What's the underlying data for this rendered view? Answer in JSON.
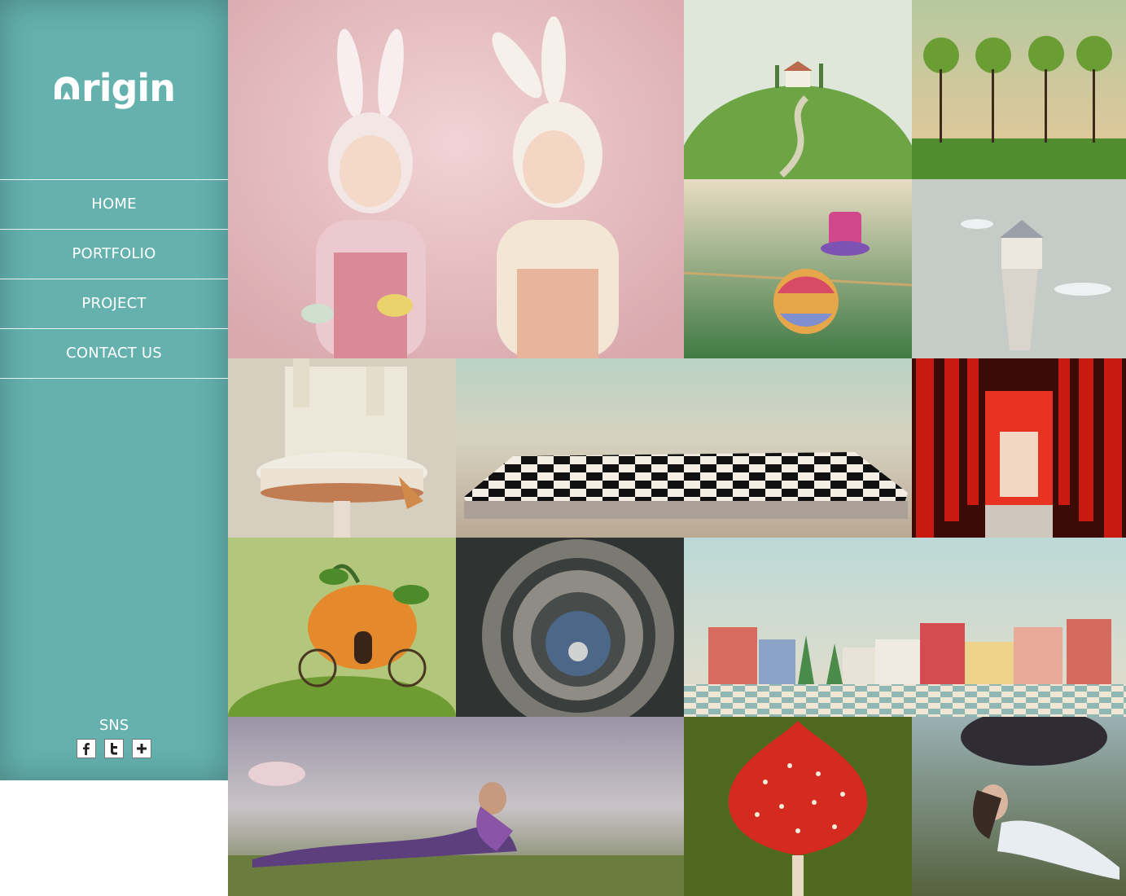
{
  "brand": {
    "logo_text": "rigin",
    "logo_alt": "Origin"
  },
  "nav": [
    {
      "label": "HOME"
    },
    {
      "label": "PORTFOLIO"
    },
    {
      "label": "PROJECT"
    },
    {
      "label": "CONTACT US"
    }
  ],
  "sns": {
    "label": "SNS",
    "icons": [
      "facebook-icon",
      "twitter-icon",
      "plus-icon"
    ]
  },
  "colors": {
    "sidebar": "#64b1ae",
    "text": "#ffffff"
  },
  "gallery": [
    {
      "name": "bunny-girls"
    },
    {
      "name": "green-hill-house"
    },
    {
      "name": "round-trees"
    },
    {
      "name": "tightrope-ball-hat"
    },
    {
      "name": "tower-castle"
    },
    {
      "name": "castle-cake"
    },
    {
      "name": "chessboard-landscape"
    },
    {
      "name": "red-torii-gates"
    },
    {
      "name": "pumpkin-carriage"
    },
    {
      "name": "spiral-staircase"
    },
    {
      "name": "toy-town"
    },
    {
      "name": "purple-dress-woman"
    },
    {
      "name": "mushroom-heart"
    },
    {
      "name": "woman-in-grass"
    }
  ]
}
